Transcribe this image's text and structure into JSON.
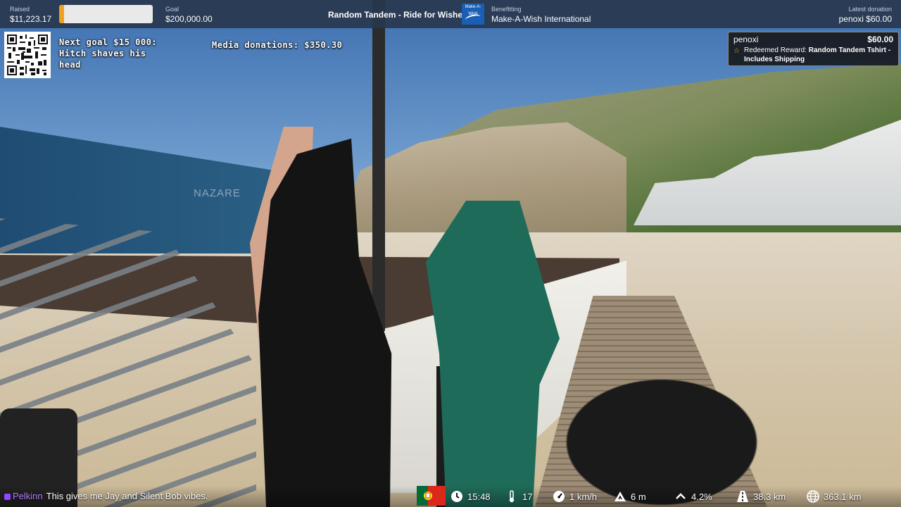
{
  "topbar": {
    "raised_label": "Raised",
    "raised_value": "$11,223.17",
    "raised_fraction": 0.056,
    "goal_label": "Goal",
    "goal_value": "$200,000.00",
    "stream_title": "Random Tandem - Ride for Wishes",
    "charity_logo_text": "Make-A-Wish",
    "benefitting_label": "Benefitting",
    "benefitting_value": "Make-A-Wish International",
    "latest_label": "Latest donation",
    "latest_value": "penoxi $60.00"
  },
  "overlay": {
    "next_goal_line1": "Next goal $15 000:",
    "next_goal_line2": "Hitch shaves his",
    "next_goal_line3": "head",
    "media_donations": "Media donations: $350.30"
  },
  "alert": {
    "user": "penoxi",
    "amount": "$60.00",
    "prefix": "Redeemed Reward: ",
    "reward": "Random Tandem Tshirt - Includes Shipping",
    "icon": "star-icon"
  },
  "scene": {
    "banner_text": "NAZARE"
  },
  "chat": {
    "user": "Pelkinn",
    "message": "This gives me Jay and Silent Bob vibes."
  },
  "stats": {
    "time": "15:48",
    "temperature": "17",
    "speed": "1 km/h",
    "altitude": "6 m",
    "grade": "4.2%",
    "distance": "38.3 km",
    "total_distance": "363.1 km",
    "icons": [
      "portugal-flag-icon",
      "clock-icon",
      "thermometer-icon",
      "speedometer-icon",
      "mountain-icon",
      "chevron-up-icon",
      "road-icon",
      "globe-icon"
    ]
  },
  "colors": {
    "topbar_bg": "#28374e",
    "progress_fill": "#f0a020",
    "chat_user": "#b47cff",
    "alert_star": "#f0b400"
  }
}
